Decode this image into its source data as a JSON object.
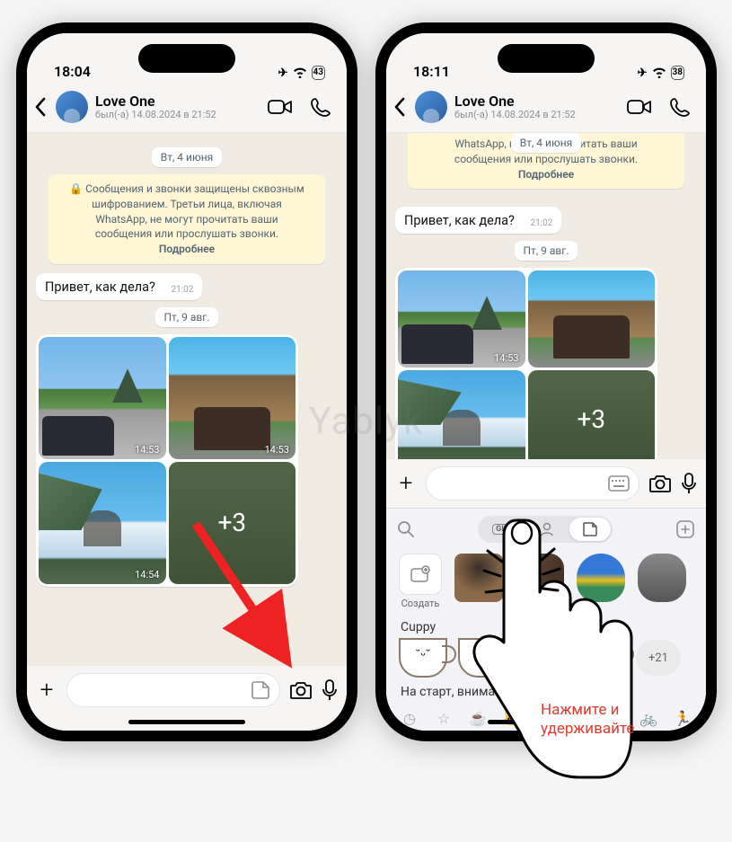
{
  "watermark": "Yablyk",
  "left": {
    "status": {
      "time": "18:04",
      "battery": "43"
    },
    "contact": {
      "name": "Love One",
      "status": "был(-а) 14.08.2024 в 21:52"
    },
    "date1": "Вт, 4 июня",
    "encryption": {
      "l1": "🔒 Сообщения и звонки защищены сквозным",
      "l2": "шифрованием. Третьи лица, включая",
      "l3": "WhatsApp, не могут прочитать ваши",
      "l4": "сообщения или прослушать звонки.",
      "more": "Подробнее"
    },
    "msg1": {
      "text": "Привет, как дела?",
      "time": "21:02"
    },
    "date2": "Пт, 9 авг.",
    "media": {
      "t1": "14:53",
      "t2": "14:53",
      "t3": "14:54",
      "more": "+3"
    }
  },
  "right": {
    "status": {
      "time": "18:11",
      "battery": "38"
    },
    "contact": {
      "name": "Love One",
      "status": "был(-а) 14.08.2024 в 21:52"
    },
    "enc_partial": {
      "l1": "WhatsApp, не могут прочитать ваши",
      "l2": "сообщения или прослушать звонки.",
      "more": "Подробнее"
    },
    "date1": "Вт, 4 июня",
    "msg1": {
      "text": "Привет, как дела?",
      "time": "21:02"
    },
    "date2": "Пт, 9 авг.",
    "media": {
      "t1": "14:53",
      "more": "+3"
    },
    "stickers": {
      "gif_label": "GIF",
      "create": "Создать",
      "pack1": "Cuppy",
      "more_count": "+21",
      "pack2": "На старт, внимани"
    }
  },
  "hand_label": {
    "l1": "Нажмите и",
    "l2": "удерживайте"
  }
}
